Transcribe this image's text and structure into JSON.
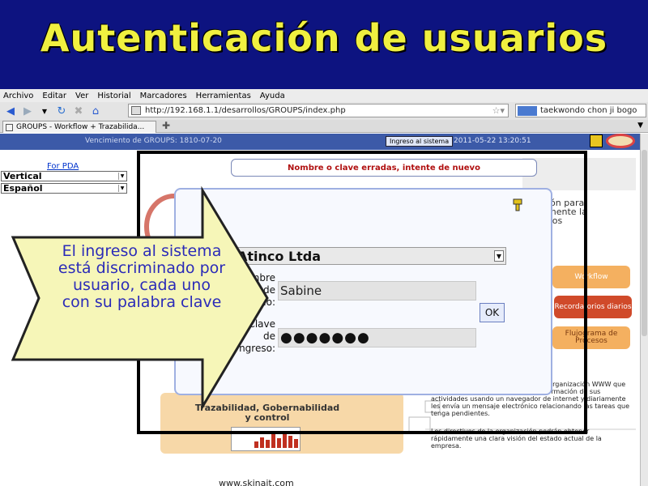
{
  "slide": {
    "title": "Autenticación de usuarios",
    "colors": {
      "header_bg": "#0d1380",
      "title": "#f0f040",
      "callout_fill": "#f6f6b8",
      "callout_text": "#2b2bb8"
    },
    "callout_text": "El ingreso al sistema está discriminado por usuario, cada uno con su palabra clave"
  },
  "browser": {
    "menu": [
      "Archivo",
      "Editar",
      "Ver",
      "Historial",
      "Marcadores",
      "Herramientas",
      "Ayuda"
    ],
    "nav_icons": [
      "back-icon",
      "forward-icon",
      "dropdown-icon",
      "reload-icon",
      "stop-icon",
      "home-icon"
    ],
    "url": "http://192.168.1.1/desarrollos/GROUPS/index.php",
    "search_value": "taekwondo chon ji bogo",
    "tab_title": "GROUPS - Workflow + Trazabilida...",
    "new_tab": "✚"
  },
  "page": {
    "vencimiento": "Vencimiento de GROUPS: 1810-07-20",
    "ingreso_button": "Ingreso al sistema",
    "datetime": "2011-05-22 13:20:51",
    "pda_link": "For PDA",
    "layout_select": "Vertical",
    "language_select": "Español",
    "error_message": "Nombre o clave erradas, intente de nuevo",
    "side_text": [
      "ión para",
      "mente la",
      "sos"
    ],
    "buttons": {
      "workflow": "Workflow",
      "recordatorios": "Recordatorios diarios",
      "flujograma": "Flujograma de Procesos"
    },
    "info_text_1": "Los clientes y los proveedores de la organización WWW que ... a su cargo pueden registrar la información de sus actividades usando un navegador de internet y diariamente les envía un mensaje electrónico relacionando las tareas que tenga pendientes.",
    "info_text_2": "Los directivos de la organización podrán obtener rápidamente una clara visión del estado actual de la empresa.",
    "trazabilidad": "Trazabilidad, Gobernabilidad y control",
    "www": "www.skinait.com",
    "bars": [
      0.35,
      0.6,
      0.45,
      0.8,
      0.55,
      0.9,
      0.7,
      0.5
    ]
  },
  "login": {
    "company": "Atinco Ltda",
    "name_label_lines": [
      "mbre",
      "de",
      "uario:"
    ],
    "pass_label_lines": [
      "Clave",
      "de",
      "ngreso:"
    ],
    "username": "Sabine",
    "password_dots": "●●●●●●●",
    "ok_label": "OK"
  }
}
